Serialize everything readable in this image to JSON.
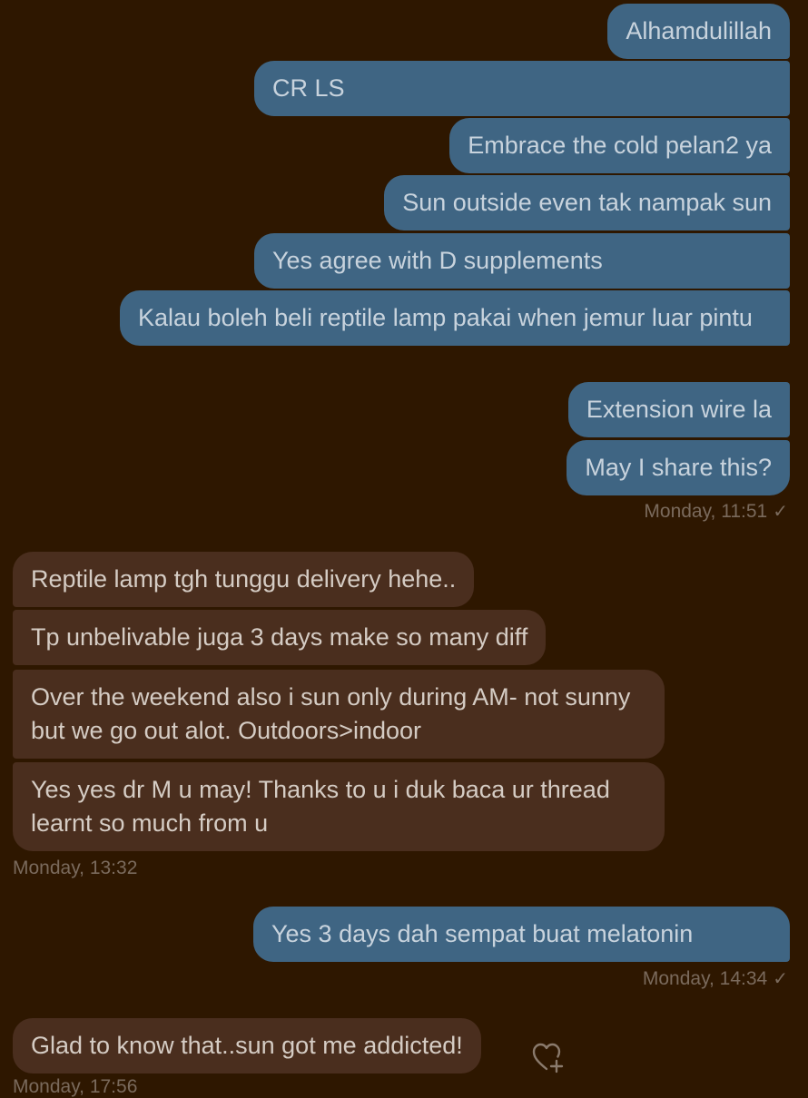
{
  "outgoing_group_1": [
    "Alhamdulillah",
    "CR LS",
    "Embrace the cold pelan2 ya",
    "Sun outside even tak nampak sun",
    "Yes agree with D supplements",
    "Kalau boleh beli reptile lamp pakai when jemur luar pintu",
    "Extension wire la",
    "May I share this?"
  ],
  "timestamp_1": "Monday, 11:51",
  "incoming_group_1": [
    "Reptile lamp tgh tunggu delivery hehe..",
    "Tp unbelivable juga 3 days make so many diff",
    "Over the weekend also i sun only during AM- not sunny but we go out alot. Outdoors>indoor",
    "Yes yes dr M u may! Thanks to u i duk baca ur thread learnt so much from u"
  ],
  "timestamp_2": "Monday, 13:32",
  "outgoing_group_2": [
    "Yes 3 days dah sempat buat melatonin"
  ],
  "timestamp_3": "Monday, 14:34",
  "incoming_group_2": [
    "Glad to know that..sun got me addicted!"
  ],
  "timestamp_4": "Monday, 17:56",
  "read_check": "✓",
  "colors": {
    "background": "#2e1700",
    "outgoing_bubble": "#3f6583",
    "incoming_bubble": "#4a2e1e"
  },
  "icons": {
    "reaction": "heart-plus-icon"
  }
}
